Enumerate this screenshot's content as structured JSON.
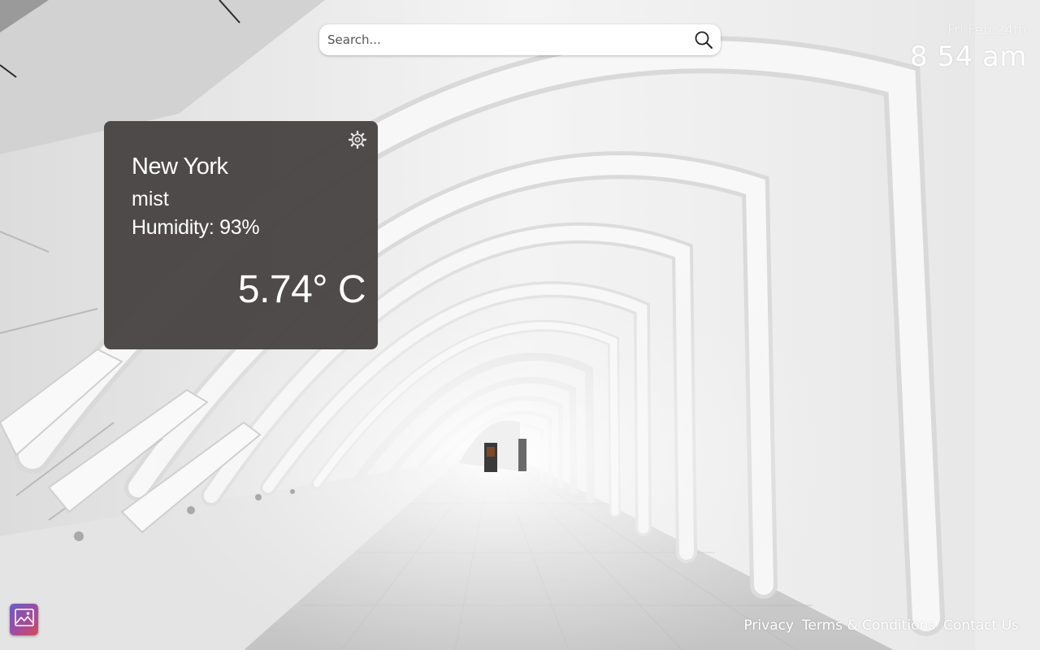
{
  "search": {
    "placeholder": "Search..."
  },
  "clock": {
    "date": "Fri Feb 24th",
    "time": "8 54 am"
  },
  "weather": {
    "city": "New York",
    "condition": "mist",
    "humidity_label": "Humidity:",
    "humidity_value": "93%",
    "temperature": "5.74° C"
  },
  "footer": {
    "links": [
      "Privacy",
      "Terms & Conditions",
      "Contact Us"
    ]
  },
  "icons": {
    "search": "search-icon",
    "settings": "gear-icon",
    "wallpaper": "image-icon"
  },
  "colors": {
    "card_background": "#484444",
    "text_light": "#ffffff",
    "wallpaper_button_gradient": [
      "#6b5bc8",
      "#a04d9d",
      "#d8495e"
    ]
  }
}
